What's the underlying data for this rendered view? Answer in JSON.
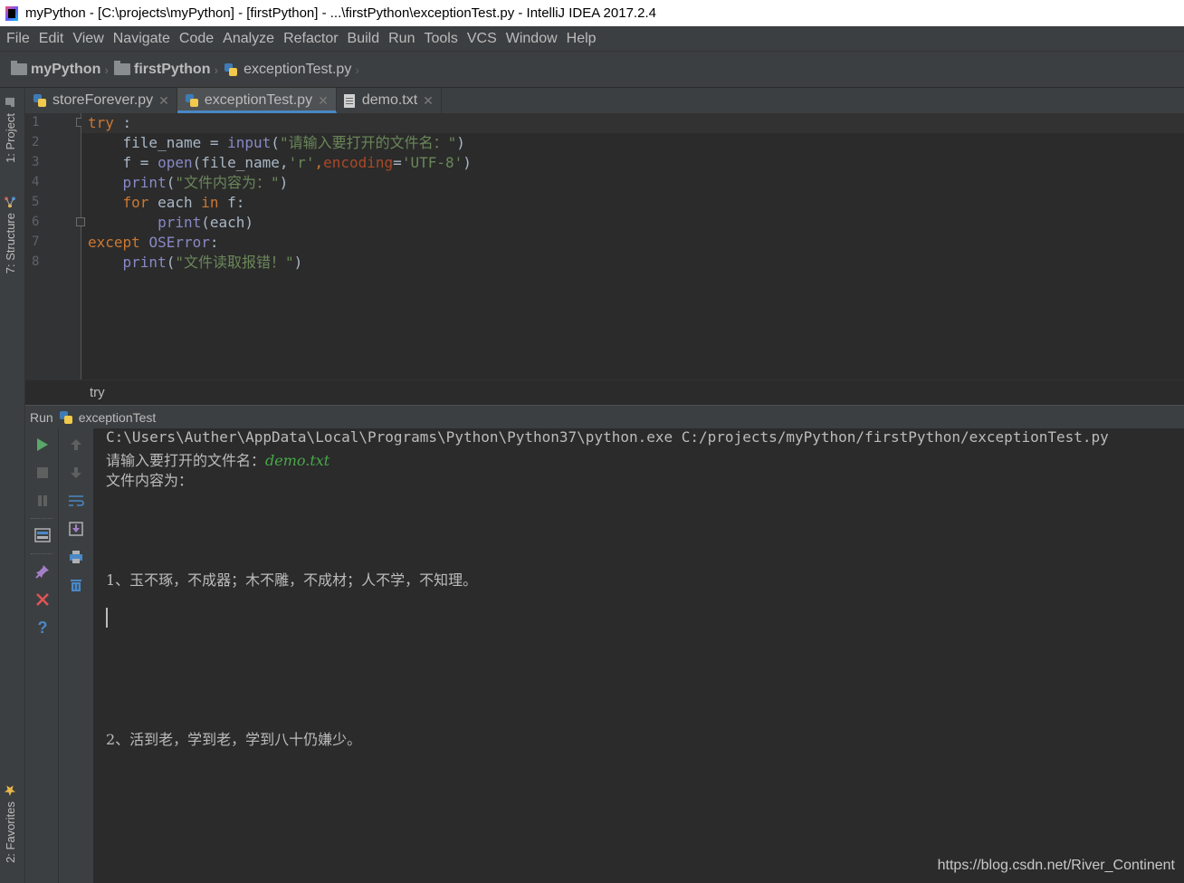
{
  "window": {
    "title": "myPython - [C:\\projects\\myPython] - [firstPython] - ...\\firstPython\\exceptionTest.py - IntelliJ IDEA 2017.2.4"
  },
  "menu": [
    "File",
    "Edit",
    "View",
    "Navigate",
    "Code",
    "Analyze",
    "Refactor",
    "Build",
    "Run",
    "Tools",
    "VCS",
    "Window",
    "Help"
  ],
  "breadcrumbs": [
    "myPython",
    "firstPython",
    "exceptionTest.py"
  ],
  "tool_stripe": {
    "project": "1: Project",
    "structure": "7: Structure",
    "favorites": "2: Favorites"
  },
  "tabs": [
    {
      "label": "storeForever.py",
      "active": false
    },
    {
      "label": "exceptionTest.py",
      "active": true
    },
    {
      "label": "demo.txt",
      "active": false
    }
  ],
  "editor": {
    "line_numbers": [
      "1",
      "2",
      "3",
      "4",
      "5",
      "6",
      "7",
      "8"
    ],
    "lines": [
      [
        {
          "t": "try",
          "c": "kw"
        },
        {
          "t": " :",
          "c": "plain"
        }
      ],
      [
        {
          "t": "    file_name = ",
          "c": "plain"
        },
        {
          "t": "input",
          "c": "fn"
        },
        {
          "t": "(",
          "c": "plain"
        },
        {
          "t": "\"请输入要打开的文件名：\"",
          "c": "str"
        },
        {
          "t": ")",
          "c": "plain"
        }
      ],
      [
        {
          "t": "    f = ",
          "c": "plain"
        },
        {
          "t": "open",
          "c": "fn"
        },
        {
          "t": "(file_name,",
          "c": "plain"
        },
        {
          "t": "'r'",
          "c": "str"
        },
        {
          "t": ",",
          "c": "kw"
        },
        {
          "t": "encoding",
          "c": "param"
        },
        {
          "t": "=",
          "c": "plain"
        },
        {
          "t": "'UTF-8'",
          "c": "str"
        },
        {
          "t": ")",
          "c": "plain"
        }
      ],
      [
        {
          "t": "    ",
          "c": "plain"
        },
        {
          "t": "print",
          "c": "fn"
        },
        {
          "t": "(",
          "c": "plain"
        },
        {
          "t": "\"文件内容为：\"",
          "c": "str"
        },
        {
          "t": ")",
          "c": "plain"
        }
      ],
      [
        {
          "t": "    ",
          "c": "plain"
        },
        {
          "t": "for",
          "c": "kw"
        },
        {
          "t": " each ",
          "c": "plain"
        },
        {
          "t": "in",
          "c": "kw"
        },
        {
          "t": " f:",
          "c": "plain"
        }
      ],
      [
        {
          "t": "        ",
          "c": "plain"
        },
        {
          "t": "print",
          "c": "fn"
        },
        {
          "t": "(each)",
          "c": "plain"
        }
      ],
      [
        {
          "t": "except",
          "c": "kw"
        },
        {
          "t": " ",
          "c": "plain"
        },
        {
          "t": "OSError",
          "c": "fn"
        },
        {
          "t": ":",
          "c": "plain"
        }
      ],
      [
        {
          "t": "    ",
          "c": "plain"
        },
        {
          "t": "print",
          "c": "fn"
        },
        {
          "t": "(",
          "c": "plain"
        },
        {
          "t": "\"文件读取报错！\"",
          "c": "str"
        },
        {
          "t": ")",
          "c": "plain"
        }
      ]
    ],
    "footer_breadcrumb": "try"
  },
  "run_panel": {
    "label": "Run",
    "config": "exceptionTest",
    "console": {
      "command": "C:\\Users\\Auther\\AppData\\Local\\Programs\\Python\\Python37\\python.exe C:/projects/myPython/firstPython/exceptionTest.py",
      "prompt": "请输入要打开的文件名：",
      "user_input": "demo.txt",
      "content_header": "文件内容为：",
      "line1": "1、玉不琢，不成器；木不雕，不成材；人不学，不知理。",
      "line2": "2、活到老，学到老，学到八十仍嫌少。"
    }
  },
  "watermark": "https://blog.csdn.net/River_Continent"
}
